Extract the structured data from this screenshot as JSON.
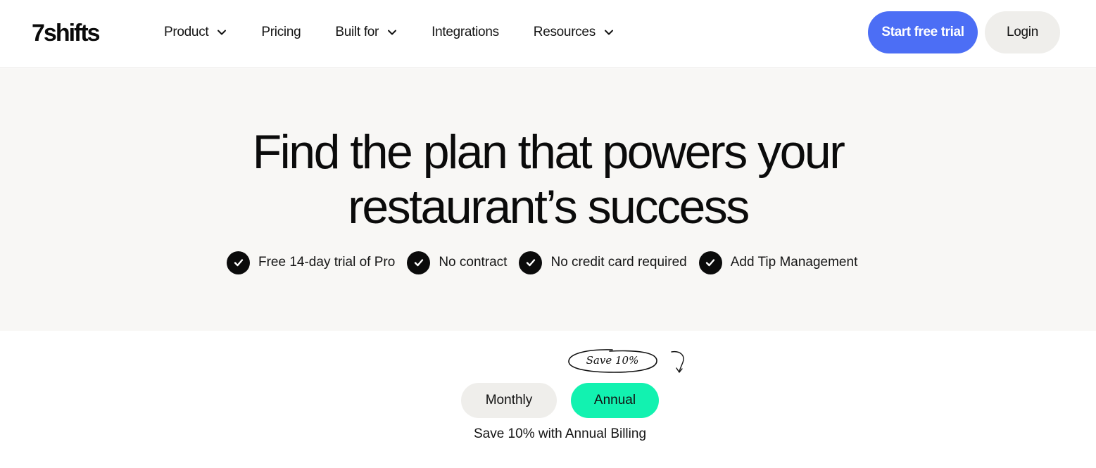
{
  "header": {
    "logo": "7shifts",
    "nav": [
      {
        "label": "Product",
        "dropdown": true
      },
      {
        "label": "Pricing",
        "dropdown": false
      },
      {
        "label": "Built for",
        "dropdown": true
      },
      {
        "label": "Integrations",
        "dropdown": false
      },
      {
        "label": "Resources",
        "dropdown": true
      }
    ],
    "cta_label": "Start free trial",
    "login_label": "Login"
  },
  "hero": {
    "title_line1": "Find the plan that powers your",
    "title_line2": "restaurant’s success",
    "benefits": [
      "Free 14-day trial of Pro",
      "No contract",
      "No credit card required",
      "Add Tip Management"
    ]
  },
  "billing": {
    "save_badge": "Save 10%",
    "monthly_label": "Monthly",
    "annual_label": "Annual",
    "selected": "Annual",
    "caption": "Save 10% with Annual Billing"
  },
  "colors": {
    "accent": "#4c6ef5",
    "annual_toggle": "#12f2b0",
    "hero_bg": "#f8f7f5",
    "pill_bg": "#efeeeb"
  },
  "icons": {
    "benefit": "check-circle-icon",
    "dropdown": "chevron-down-icon",
    "annotation": "curved-arrow-icon"
  }
}
